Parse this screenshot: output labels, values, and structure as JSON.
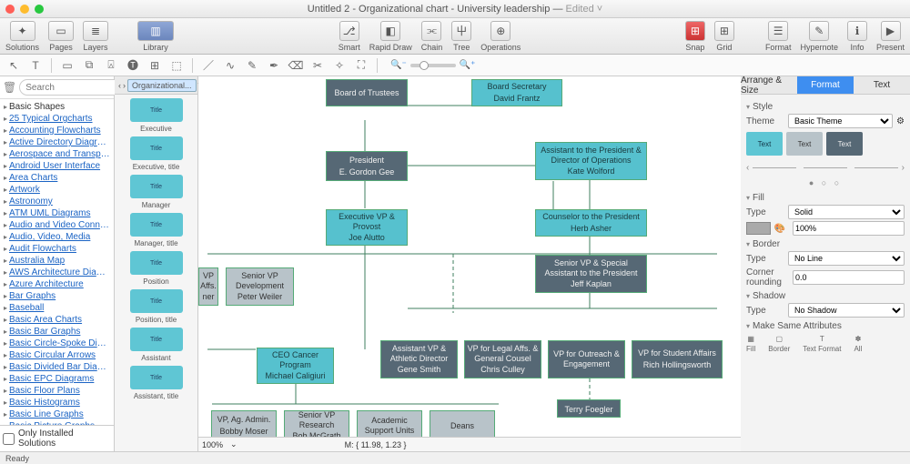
{
  "title": {
    "doc": "Untitled 2",
    "template": "Organizational chart",
    "subject": "University leadership",
    "state": "Edited"
  },
  "toolbar": {
    "solutions": "Solutions",
    "pages": "Pages",
    "layers": "Layers",
    "library": "Library",
    "smart": "Smart",
    "rapid": "Rapid Draw",
    "chain": "Chain",
    "tree": "Tree",
    "operations": "Operations",
    "snap": "Snap",
    "grid": "Grid",
    "format": "Format",
    "hypernote": "Hypernote",
    "info": "Info",
    "present": "Present"
  },
  "search": {
    "placeholder": "Search"
  },
  "library": {
    "items": [
      "Basic Shapes",
      "25 Typical Orgcharts",
      "Accounting Flowcharts",
      "Active Directory Diagrams",
      "Aerospace and Transport",
      "Android User Interface",
      "Area Charts",
      "Artwork",
      "Astronomy",
      "ATM UML Diagrams",
      "Audio and Video Connectors",
      "Audio, Video, Media",
      "Audit Flowcharts",
      "Australia Map",
      "AWS Architecture Diagrams",
      "Azure Architecture",
      "Bar Graphs",
      "Baseball",
      "Basic Area Charts",
      "Basic Bar Graphs",
      "Basic Circle-Spoke Diagrams",
      "Basic Circular Arrows",
      "Basic Divided Bar Diagrams",
      "Basic EPC Diagrams",
      "Basic Floor Plans",
      "Basic Histograms",
      "Basic Line Graphs",
      "Basic Picture Graphs"
    ],
    "footer": "Only Installed Solutions"
  },
  "shapes": {
    "tab": "Organizational...",
    "items": [
      "Executive",
      "Executive, title",
      "Manager",
      "Manager, title",
      "Position",
      "Position, title",
      "Assistant",
      "Assistant, title"
    ]
  },
  "chart": {
    "nodes": {
      "board": {
        "t": "Board of Trustees",
        "s": ""
      },
      "secretary": {
        "t": "Board Secretary",
        "s": "David Frantz"
      },
      "president": {
        "t": "President",
        "s": "E. Gordon Gee"
      },
      "asst_dir": {
        "t": "Assistant to the President & Director of Operations",
        "s": "Kate Wolford"
      },
      "provost": {
        "t": "Executive VP & Provost",
        "s": "Joe Alutto"
      },
      "counselor": {
        "t": "Counselor to the President",
        "s": "Herb Asher"
      },
      "svp_special": {
        "t": "Senior VP & Special Assistant to the President",
        "s": "Jeff Kaplan"
      },
      "vp_affs": {
        "t": "VP Affs.",
        "s": "ner"
      },
      "svp_dev": {
        "t": "Senior VP Development",
        "s": "Peter Weiler"
      },
      "ceo_cancer": {
        "t": "CEO Cancer Program",
        "s": "Michael Caligiuri"
      },
      "avp_athletic": {
        "t": "Assistant VP & Athletic Director",
        "s": "Gene Smith"
      },
      "vp_legal": {
        "t": "VP for Legal Affs. & General Cousel",
        "s": "Chris Culley"
      },
      "vp_outreach": {
        "t": "VP for Outreach & Engagement",
        "s": ""
      },
      "vp_student": {
        "t": "VP for Student Affairs",
        "s": "Rich Hollingsworth"
      },
      "terry": {
        "t": "",
        "s": "Terry Foegler"
      },
      "vp_ag": {
        "t": "VP, Ag. Admin.",
        "s": "Bobby Moser"
      },
      "svp_research": {
        "t": "Senior VP Research",
        "s": "Bob McGrath"
      },
      "asu": {
        "t": "Academic Support Units",
        "s": ""
      },
      "deans": {
        "t": "Deans",
        "s": ""
      }
    }
  },
  "canvas": {
    "zoom": "100%",
    "mouse_label": "M:",
    "mouse": "11.98, 1.23"
  },
  "inspector": {
    "tabs": [
      "Arrange & Size",
      "Format",
      "Text"
    ],
    "style_h": "Style",
    "theme_lbl": "Theme",
    "theme": "Basic Theme",
    "swatch_text": "Text",
    "fill_h": "Fill",
    "type_lbl": "Type",
    "fill_type": "Solid",
    "fill_pct": "100%",
    "border_h": "Border",
    "border_type": "No Line",
    "corner_lbl": "Corner rounding",
    "corner": "0.0",
    "shadow_h": "Shadow",
    "shadow_type": "No Shadow",
    "attrs_h": "Make Same Attributes",
    "attrs": [
      "Fill",
      "Border",
      "Text Format",
      "All"
    ]
  },
  "status": "Ready"
}
